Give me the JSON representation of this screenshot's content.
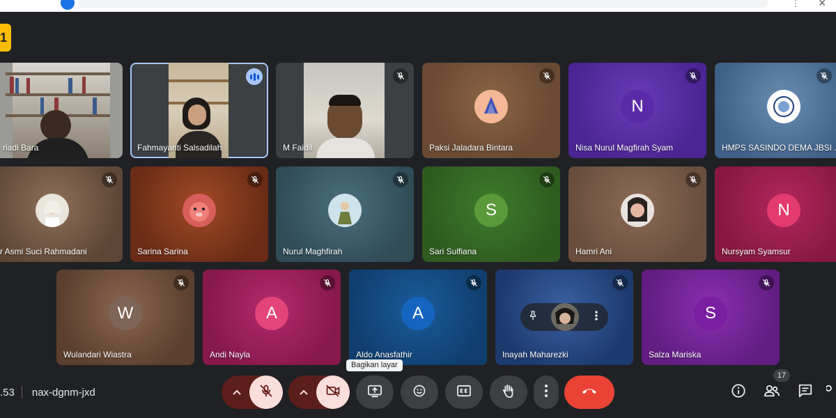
{
  "meeting": {
    "time_fragment": ".53",
    "code": "nax-dgnm-jxd",
    "participant_count": "17"
  },
  "tooltip": "Bagikan layar",
  "host_chip": "1",
  "participants": [
    {
      "name": "riadi Bara"
    },
    {
      "name": "Fahmayanti Salsadilah"
    },
    {
      "name": "M Faidil"
    },
    {
      "name": "Paksi Jaladara Bintara"
    },
    {
      "name": "Nisa Nurul Magfirah Syam",
      "initial": "N"
    },
    {
      "name": "HMPS SASINDO DEMA JBSI ..."
    },
    {
      "name": "r Asmi Suci Rahmadani"
    },
    {
      "name": "Sarina Sarina"
    },
    {
      "name": "Nurul Maghfirah"
    },
    {
      "name": "Sari Sulfiana",
      "initial": "S"
    },
    {
      "name": "Hamri Ani"
    },
    {
      "name": "Nursyam Syamsur",
      "initial": "N"
    },
    {
      "name": "Wulandari Wiastra",
      "initial": "W"
    },
    {
      "name": "Andi Nayla",
      "initial": "A"
    },
    {
      "name": "Aldo Anasfathir",
      "initial": "A"
    },
    {
      "name": "Inayah Maharezki"
    },
    {
      "name": "Salza Mariska",
      "initial": "S"
    }
  ],
  "colors": {
    "mic_off_bg": "#f9dedc",
    "end_call": "#ea4335",
    "active_border": "#a8c7fa",
    "host_chip": "#fbbc04"
  },
  "icons": {
    "mic": "mic-off-icon",
    "camera": "camera-off-icon",
    "present": "present-screen-icon",
    "reactions": "emoji-icon",
    "captions": "captions-icon",
    "hand": "raise-hand-icon",
    "more": "more-options-icon",
    "hangup": "end-call-icon",
    "info": "info-icon",
    "people": "people-icon",
    "chat": "chat-icon"
  }
}
